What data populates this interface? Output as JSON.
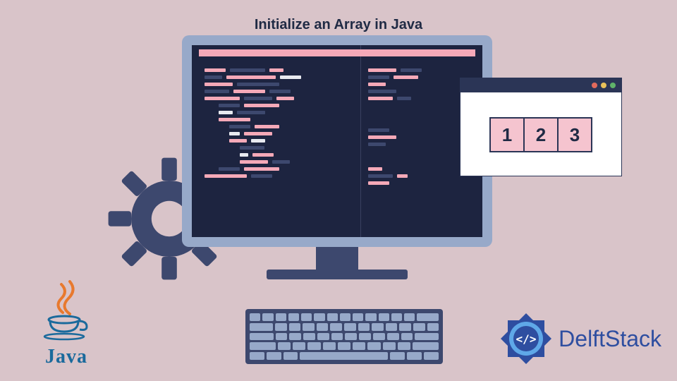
{
  "title": "Initialize an Array in Java",
  "array": {
    "cells": [
      "1",
      "2",
      "3"
    ]
  },
  "logos": {
    "java": "Java",
    "delftstack": "DelftStack"
  },
  "colors": {
    "background": "#d9c4c9",
    "monitor_frame": "#97a9c9",
    "screen": "#1d2440",
    "accent_pink": "#f5a9b8",
    "navy": "#3d486e",
    "java_blue": "#1a6a9c",
    "delft_blue": "#2e4ea0"
  }
}
